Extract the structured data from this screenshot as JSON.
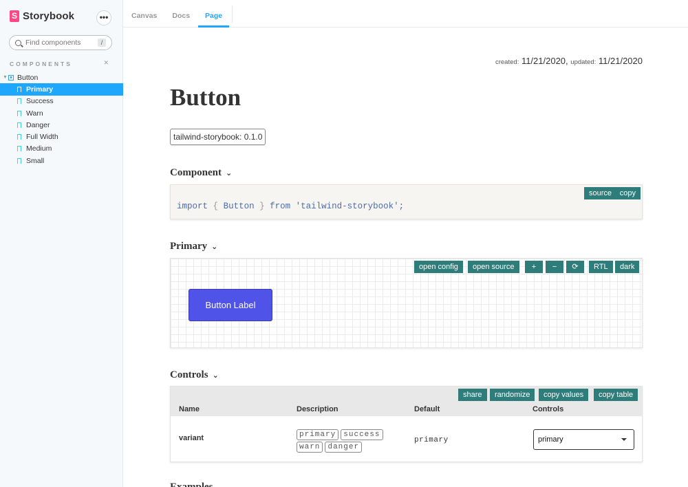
{
  "sidebar": {
    "logo_letter": "S",
    "app_name": "Storybook",
    "menu_glyph": "•••",
    "search": {
      "placeholder": "Find components",
      "shortcut": "/"
    },
    "section_title": "COMPONENTS",
    "component": "Button",
    "stories": [
      {
        "label": "Primary",
        "active": true
      },
      {
        "label": "Success",
        "active": false
      },
      {
        "label": "Warn",
        "active": false
      },
      {
        "label": "Danger",
        "active": false
      },
      {
        "label": "Full Width",
        "active": false
      },
      {
        "label": "Medium",
        "active": false
      },
      {
        "label": "Small",
        "active": false
      }
    ]
  },
  "tabs": [
    {
      "label": "Canvas",
      "active": false
    },
    {
      "label": "Docs",
      "active": false
    },
    {
      "label": "Page",
      "active": true
    }
  ],
  "page": {
    "created_label": "created:",
    "created": "11/21/2020,",
    "updated_label": "updated:",
    "updated": "11/21/2020",
    "title": "Button",
    "version": "tailwind-storybook: 0.1.0"
  },
  "component_section": {
    "heading": "Component",
    "code": {
      "import": "import",
      "lb": "{",
      "name": "Button",
      "rb": "}",
      "from": "from",
      "module": "'tailwind-storybook';"
    },
    "buttons": {
      "source": "source",
      "copy": "copy"
    }
  },
  "primary_section": {
    "heading": "Primary",
    "toolbar": {
      "open_config": "open config",
      "open_source": "open source",
      "zoom_in": "+",
      "zoom_out": "−",
      "reset": "⟳",
      "rtl": "RTL",
      "dark": "dark"
    },
    "demo_button": "Button Label"
  },
  "controls_section": {
    "heading": "Controls",
    "toolbar": {
      "share": "share",
      "randomize": "randomize",
      "copy_values": "copy values",
      "copy_table": "copy table"
    },
    "columns": [
      "Name",
      "Description",
      "Default",
      "Controls"
    ],
    "rows": [
      {
        "name": "variant",
        "options": [
          "primary",
          "success",
          "warn",
          "danger"
        ],
        "default": "primary",
        "value": "primary"
      }
    ]
  },
  "next_heading": "Examples",
  "colors": {
    "accent": "#1ea7fd",
    "toolbar": "#2e7d7a",
    "demo_button": "#4f53e8",
    "brand": "#ff4785"
  }
}
